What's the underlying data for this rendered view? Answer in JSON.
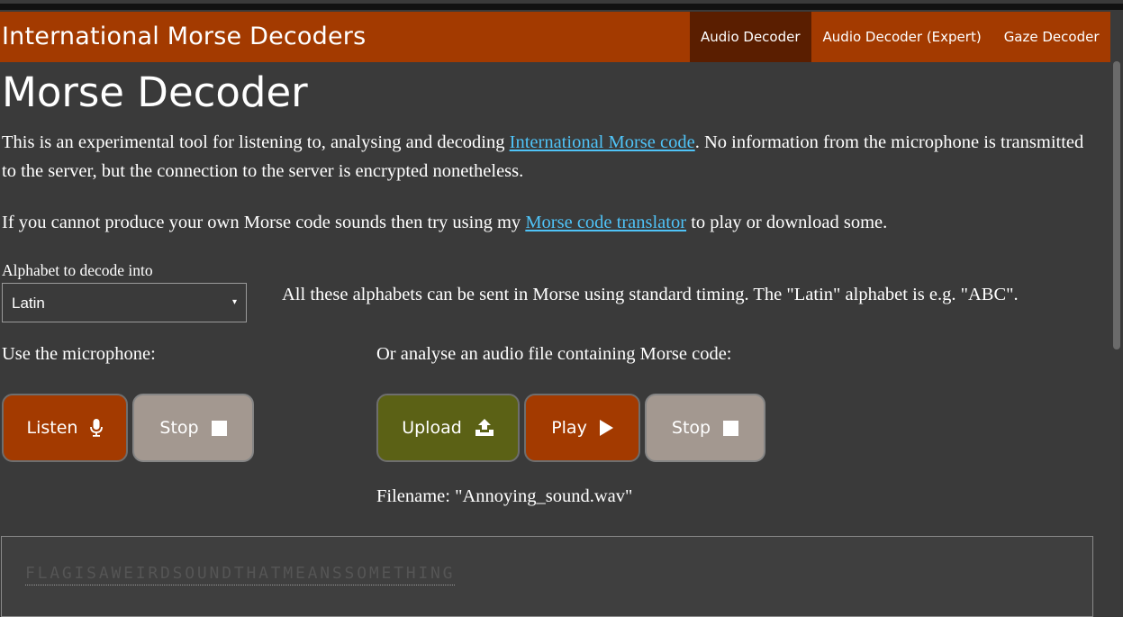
{
  "app": {
    "title": "International Morse Decoders",
    "accent_color": "#a33a00",
    "nav": [
      {
        "label": "Audio Decoder",
        "active": true
      },
      {
        "label": "Audio Decoder (Expert)",
        "active": false
      },
      {
        "label": "Gaze Decoder",
        "active": false
      }
    ]
  },
  "page": {
    "heading": "Morse Decoder",
    "intro": {
      "before_link": "This is an experimental tool for listening to, analysing and decoding ",
      "link": "International Morse code",
      "after_link": ". No information from the microphone is transmitted to the server, but the connection to the server is encrypted nonetheless."
    },
    "translator": {
      "before_link": "If you cannot produce your own Morse code sounds then try using my ",
      "link": "Morse code translator",
      "after_link": " to play or download some."
    }
  },
  "alphabet": {
    "label": "Alphabet to decode into",
    "selected": "Latin",
    "note": "All these alphabets can be sent in Morse using standard timing. The \"Latin\" alphabet is e.g. \"ABC\"."
  },
  "microphone": {
    "label": "Use the microphone:",
    "listen_label": "Listen",
    "listen_icon": "microphone-icon",
    "stop_label": "Stop",
    "stop_icon": "stop-icon"
  },
  "file": {
    "label": "Or analyse an audio file containing Morse code:",
    "upload_label": "Upload",
    "upload_icon": "upload-icon",
    "play_label": "Play",
    "play_icon": "play-icon",
    "stop_label": "Stop",
    "stop_icon": "stop-icon",
    "filename": "Filename: \"Annoying_sound.wav\""
  },
  "output": {
    "decoded_text": "FLAGISAWEIRDSOUNDTHATMEANSSOMETHING"
  }
}
